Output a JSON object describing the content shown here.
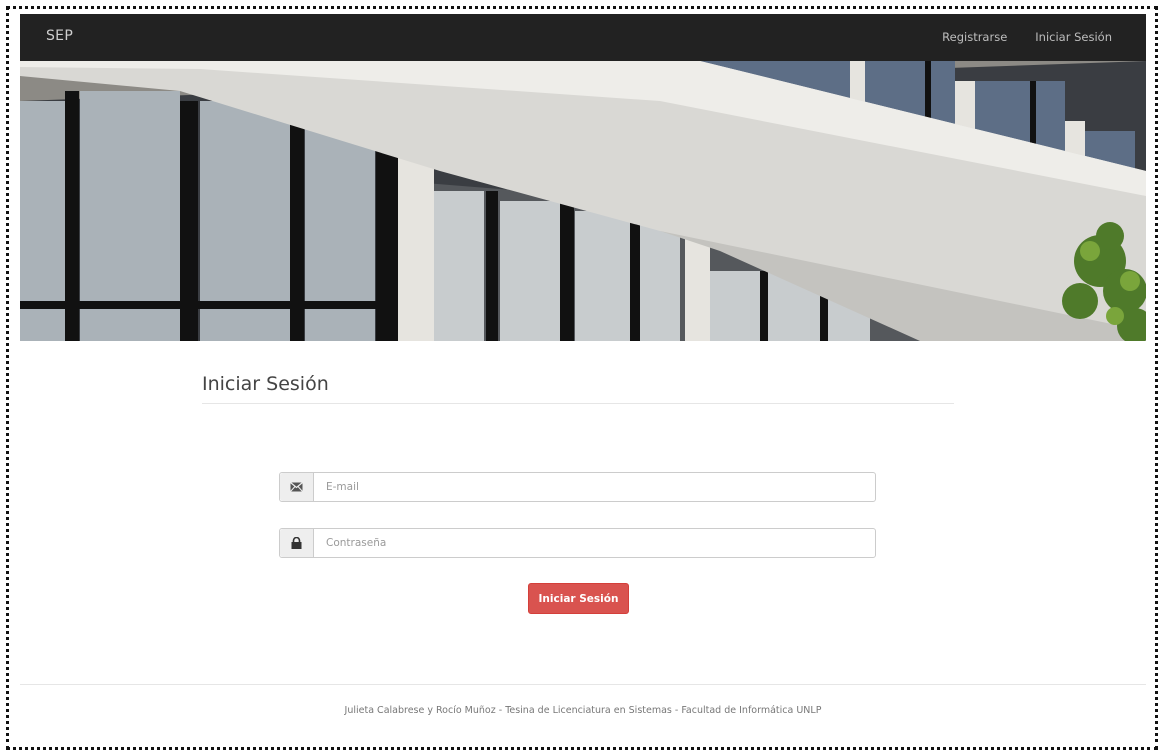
{
  "navbar": {
    "brand": "SEP",
    "links": [
      {
        "label": "Registrarse"
      },
      {
        "label": "Iniciar Sesión"
      }
    ]
  },
  "hero": {
    "icon": "building-photo"
  },
  "form": {
    "title": "Iniciar Sesión",
    "email": {
      "placeholder": "E-mail",
      "value": "",
      "icon": "envelope-icon"
    },
    "password": {
      "placeholder": "Contraseña",
      "value": "",
      "icon": "lock-icon"
    },
    "submit_label": "Iniciar Sesión"
  },
  "footer": {
    "text": "Julieta Calabrese y Rocío Muñoz - Tesina de Licenciatura en Sistemas - Facultad de Informática UNLP"
  },
  "colors": {
    "navbar_bg": "#222222",
    "button_bg": "#d9534f"
  }
}
